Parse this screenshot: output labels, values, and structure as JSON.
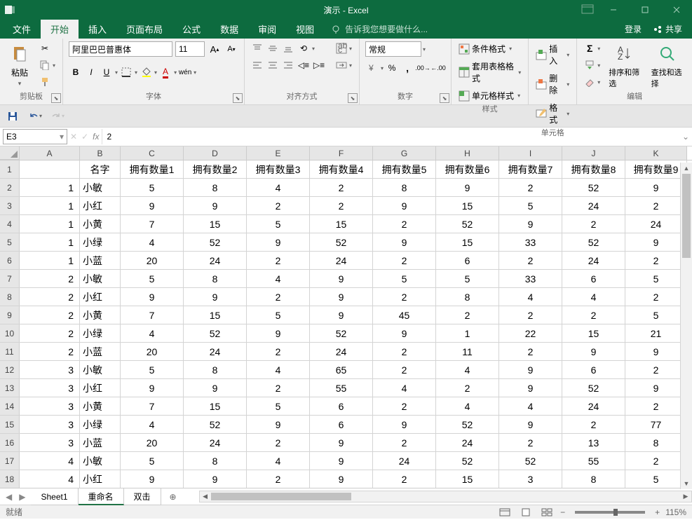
{
  "title": "演示 - Excel",
  "tabs": {
    "file": "文件",
    "home": "开始",
    "insert": "插入",
    "layout": "页面布局",
    "formulas": "公式",
    "data": "数据",
    "review": "审阅",
    "view": "视图"
  },
  "tellme": "告诉我您想要做什么...",
  "login": "登录",
  "share": "共享",
  "ribbon": {
    "clipboard": "剪贴板",
    "paste": "粘贴",
    "font": "字体",
    "fontName": "阿里巴巴普惠体",
    "fontSize": "11",
    "align": "对齐方式",
    "wrap": "",
    "merge": "",
    "number": "数字",
    "numberFmt": "常规",
    "styles": "样式",
    "condFmt": "条件格式",
    "tableFmt": "套用表格格式",
    "cellStyle": "单元格样式",
    "cells": "单元格",
    "insertCell": "插入",
    "deleteCell": "删除",
    "formatCell": "格式",
    "editing": "编辑",
    "sort": "排序和筛选",
    "find": "查找和选择"
  },
  "nameBox": "E3",
  "formulaValue": "2",
  "columns": [
    "A",
    "B",
    "C",
    "D",
    "E",
    "F",
    "G",
    "H",
    "I",
    "J",
    "K"
  ],
  "headers": [
    "",
    "名字",
    "拥有数量1",
    "拥有数量2",
    "拥有数量3",
    "拥有数量4",
    "拥有数量5",
    "拥有数量6",
    "拥有数量7",
    "拥有数量8",
    "拥有数量9"
  ],
  "rows": [
    [
      1,
      "小敏",
      5,
      8,
      4,
      2,
      8,
      9,
      2,
      52,
      9
    ],
    [
      1,
      "小红",
      9,
      9,
      2,
      2,
      9,
      15,
      5,
      24,
      2
    ],
    [
      1,
      "小黄",
      7,
      15,
      5,
      15,
      2,
      52,
      9,
      2,
      24
    ],
    [
      1,
      "小绿",
      4,
      52,
      9,
      52,
      9,
      15,
      33,
      52,
      9
    ],
    [
      1,
      "小蓝",
      20,
      24,
      2,
      24,
      2,
      6,
      2,
      24,
      2
    ],
    [
      2,
      "小敏",
      5,
      8,
      4,
      9,
      5,
      5,
      33,
      6,
      5
    ],
    [
      2,
      "小红",
      9,
      9,
      2,
      9,
      2,
      8,
      4,
      4,
      2
    ],
    [
      2,
      "小黄",
      7,
      15,
      5,
      9,
      45,
      2,
      2,
      2,
      5
    ],
    [
      2,
      "小绿",
      4,
      52,
      9,
      52,
      9,
      1,
      22,
      15,
      21
    ],
    [
      2,
      "小蓝",
      20,
      24,
      2,
      24,
      2,
      11,
      2,
      9,
      9
    ],
    [
      3,
      "小敏",
      5,
      8,
      4,
      65,
      2,
      4,
      9,
      6,
      2
    ],
    [
      3,
      "小红",
      9,
      9,
      2,
      55,
      4,
      2,
      9,
      52,
      9
    ],
    [
      3,
      "小黄",
      7,
      15,
      5,
      6,
      2,
      4,
      4,
      24,
      2
    ],
    [
      3,
      "小绿",
      4,
      52,
      9,
      6,
      9,
      52,
      9,
      2,
      77
    ],
    [
      3,
      "小蓝",
      20,
      24,
      2,
      9,
      2,
      24,
      2,
      13,
      8
    ],
    [
      4,
      "小敏",
      5,
      8,
      4,
      9,
      24,
      52,
      52,
      55,
      2
    ],
    [
      4,
      "小红",
      9,
      9,
      2,
      9,
      2,
      15,
      3,
      8,
      5
    ]
  ],
  "sheets": {
    "s1": "Sheet1",
    "s2": "重命名",
    "s3": "双击"
  },
  "status": {
    "ready": "就绪",
    "zoom": "115%"
  }
}
